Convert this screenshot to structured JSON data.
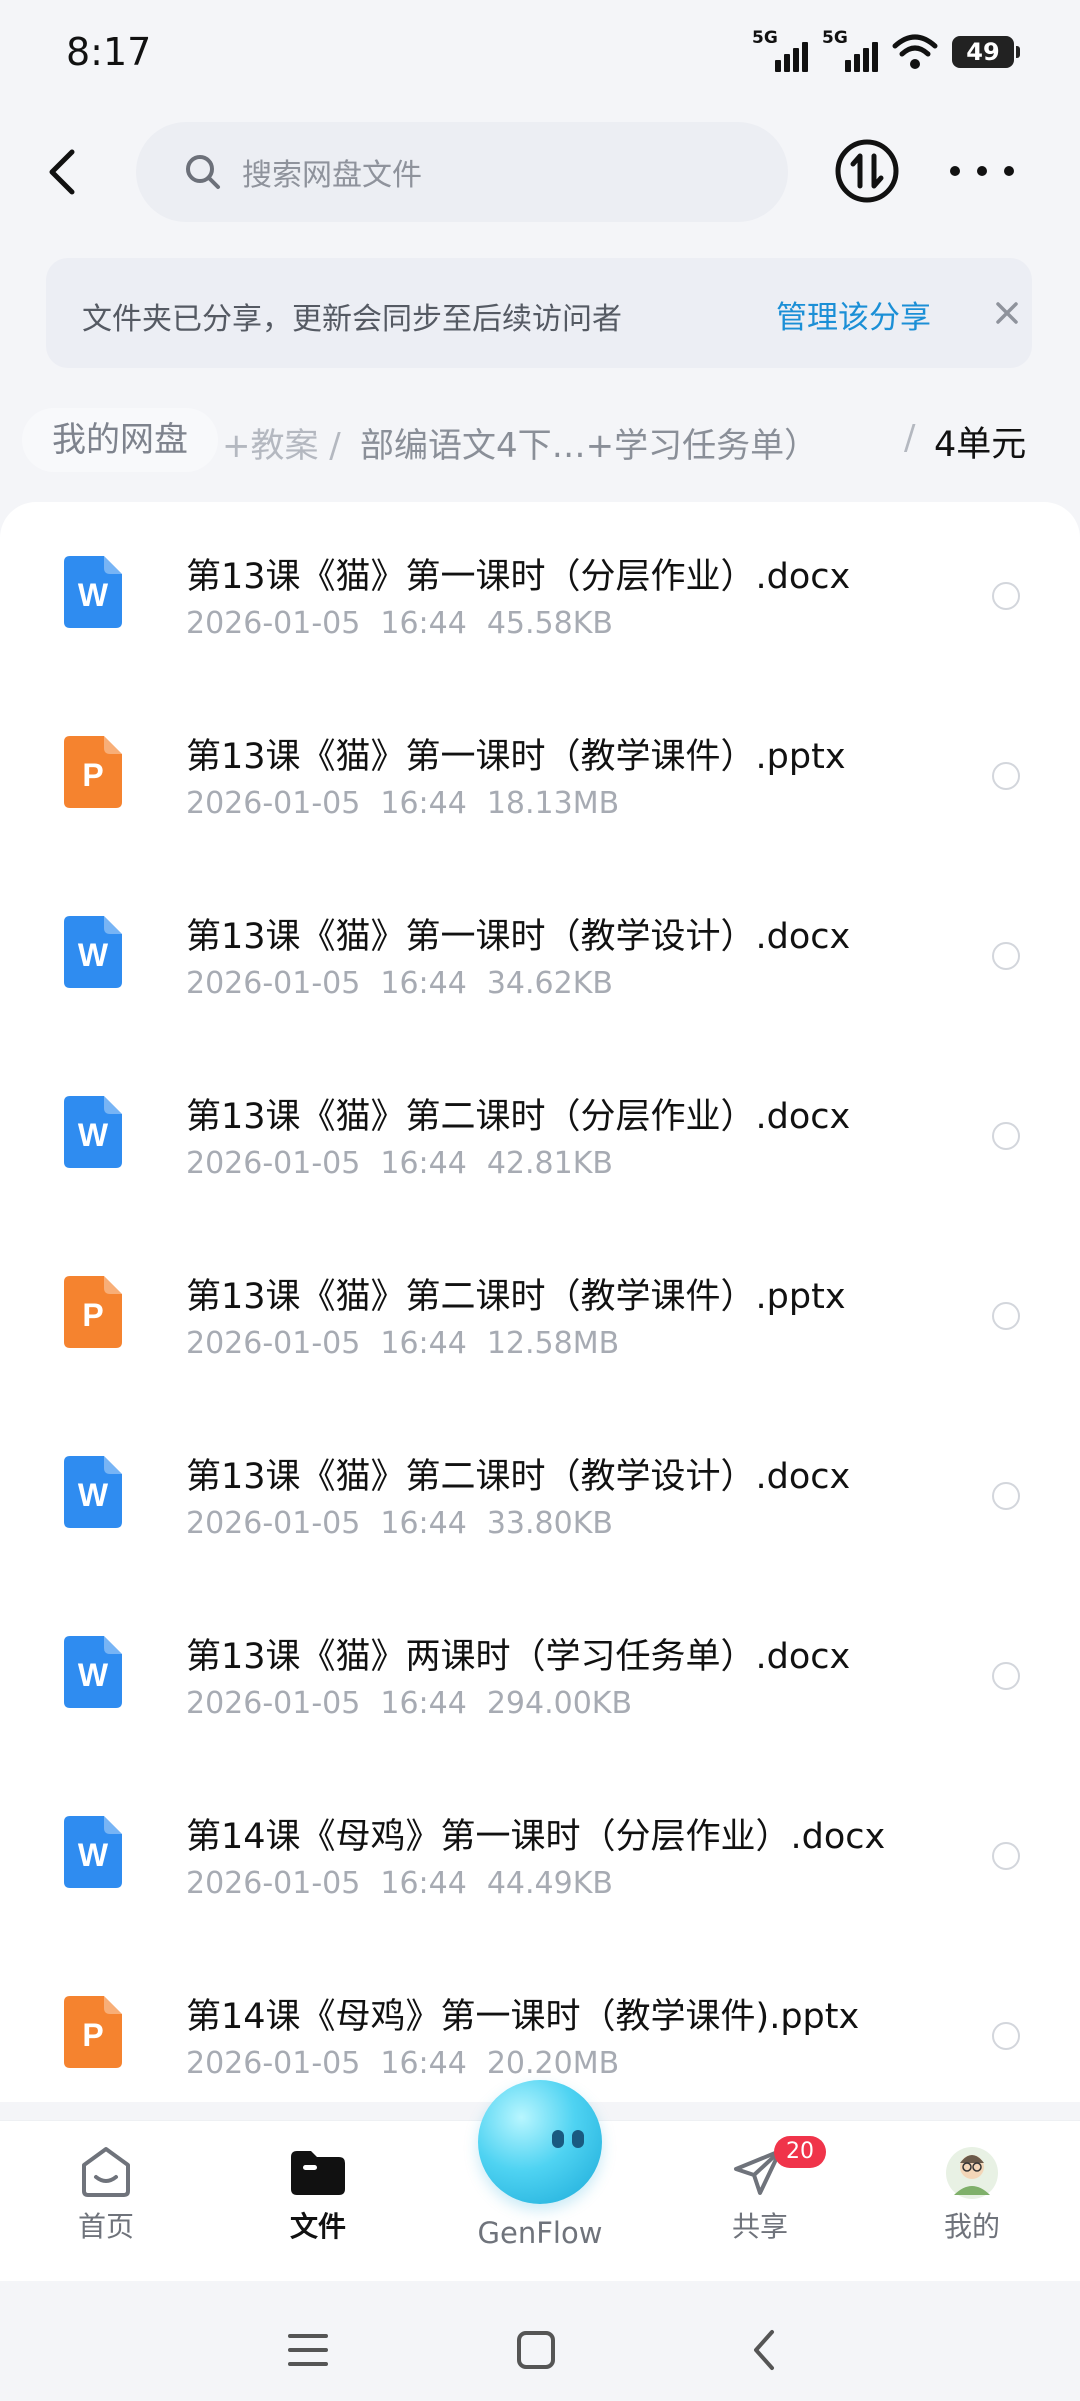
{
  "status_bar": {
    "time": "8:17",
    "sim1": "5G",
    "sim2": "5G",
    "battery": "49"
  },
  "header": {
    "search_placeholder": "搜索网盘文件",
    "back_icon": "chevron-left-icon",
    "transfer_icon": "transfer-icon",
    "more_icon": "more-icon"
  },
  "share_banner": {
    "message": "文件夹已分享，更新会同步至后续访问者",
    "action": "管理该分享",
    "close_icon": "close-icon"
  },
  "breadcrumb": {
    "root": "我的网盘",
    "faded": "+教案 /",
    "middle": "部编语文4下…+学习任务单）",
    "separator": "/",
    "current": "4单元"
  },
  "files": [
    {
      "name": "第13课《猫》第一课时（分层作业）.docx",
      "date": "2026-01-05",
      "time": "16:44",
      "size": "45.58KB",
      "type": "word"
    },
    {
      "name": "第13课《猫》第一课时（教学课件）.pptx",
      "date": "2026-01-05",
      "time": "16:44",
      "size": "18.13MB",
      "type": "ppt"
    },
    {
      "name": "第13课《猫》第一课时（教学设计）.docx",
      "date": "2026-01-05",
      "time": "16:44",
      "size": "34.62KB",
      "type": "word"
    },
    {
      "name": "第13课《猫》第二课时（分层作业）.docx",
      "date": "2026-01-05",
      "time": "16:44",
      "size": "42.81KB",
      "type": "word"
    },
    {
      "name": "第13课《猫》第二课时（教学课件）.pptx",
      "date": "2026-01-05",
      "time": "16:44",
      "size": "12.58MB",
      "type": "ppt"
    },
    {
      "name": "第13课《猫》第二课时（教学设计）.docx",
      "date": "2026-01-05",
      "time": "16:44",
      "size": "33.80KB",
      "type": "word"
    },
    {
      "name": "第13课《猫》两课时（学习任务单）.docx",
      "date": "2026-01-05",
      "time": "16:44",
      "size": "294.00KB",
      "type": "word"
    },
    {
      "name": "第14课《母鸡》第一课时（分层作业）.docx",
      "date": "2026-01-05",
      "time": "16:44",
      "size": "44.49KB",
      "type": "word"
    },
    {
      "name": "第14课《母鸡》第一课时（教学课件).pptx",
      "date": "2026-01-05",
      "time": "16:44",
      "size": "20.20MB",
      "type": "ppt"
    }
  ],
  "nav": {
    "home": "首页",
    "files": "文件",
    "genflow": "GenFlow",
    "share": "共享",
    "share_badge": "20",
    "me": "我的"
  },
  "colors": {
    "word": "#2f8cf0",
    "ppt": "#f5832f",
    "accent": "#1b8fd6",
    "badge": "#f0344a"
  }
}
